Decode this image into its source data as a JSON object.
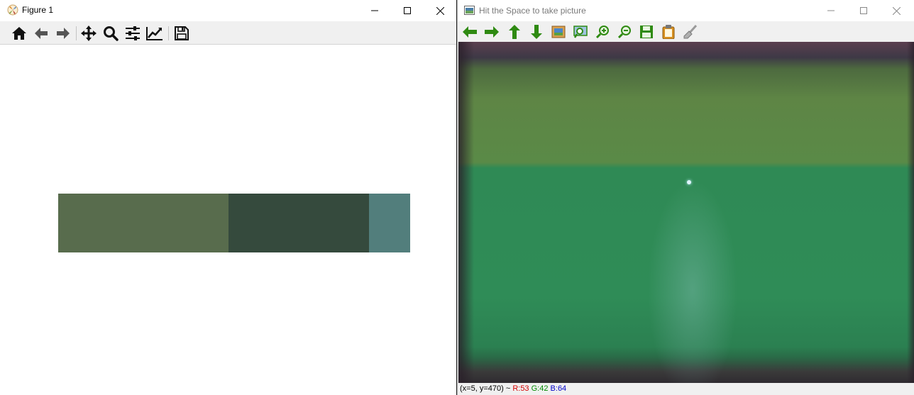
{
  "figure_window": {
    "title": "Figure 1",
    "toolbar": [
      "home-icon",
      "back-icon",
      "forward-icon",
      "pan-icon",
      "zoom-icon",
      "configure-subplots-icon",
      "edit-axis-icon",
      "save-icon"
    ],
    "palette_colors": [
      {
        "color": "#586c4d",
        "fraction": 0.484
      },
      {
        "color": "#354a3d",
        "fraction": 0.399
      },
      {
        "color": "#527e7c",
        "fraction": 0.117
      }
    ]
  },
  "camera_window": {
    "title": "Hit the Space to take picture",
    "toolbar": [
      "pan-left-icon",
      "pan-right-icon",
      "pan-up-icon",
      "pan-down-icon",
      "zoom-fit-icon",
      "zoom-window-icon",
      "zoom-in-icon",
      "zoom-out-icon",
      "save-image-icon",
      "copy-clipboard-icon",
      "properties-icon"
    ],
    "status": {
      "coords": "(x=5, y=470) ~",
      "r": "R:53",
      "g": "G:42",
      "b": "B:64"
    }
  }
}
